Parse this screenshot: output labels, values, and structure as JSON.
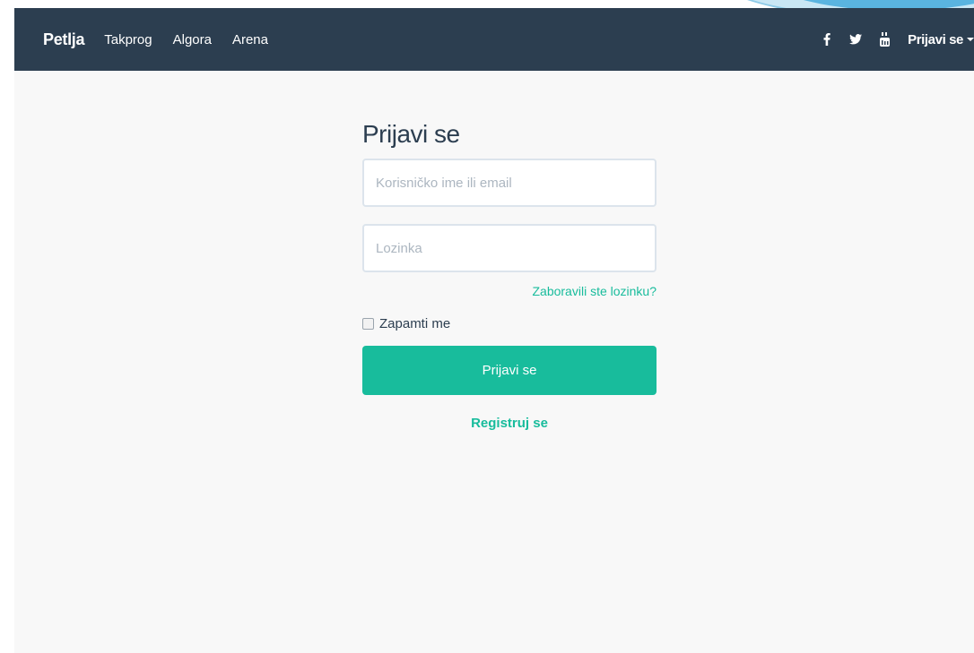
{
  "navbar": {
    "brand": "Petlja",
    "links": [
      "Takprog",
      "Algora",
      "Arena"
    ],
    "social_icons": [
      "facebook-icon",
      "twitter-icon",
      "youtube-icon"
    ],
    "login_menu": "Prijavi se",
    "background": "#2c3e50"
  },
  "login": {
    "title": "Prijavi se",
    "username_placeholder": "Korisničko ime ili email",
    "username_value": "",
    "password_placeholder": "Lozinka",
    "password_value": "",
    "forgot_password": "Zaboravili ste lozinku?",
    "remember_me": "Zapamti me",
    "remember_checked": false,
    "submit_label": "Prijavi se",
    "register_link": "Registruj se",
    "accent": "#18bc9c"
  }
}
